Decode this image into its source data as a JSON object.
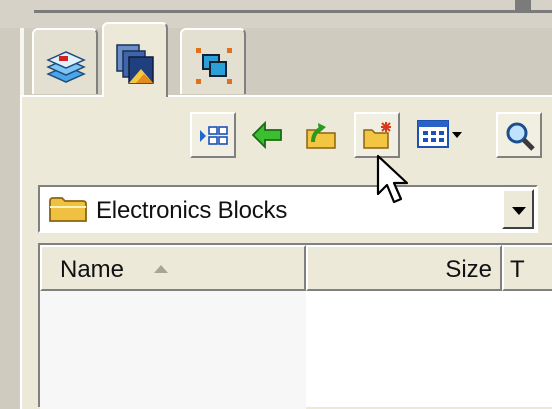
{
  "tabs": [
    {
      "name": "layers",
      "icon": "layers-icon"
    },
    {
      "name": "blocks",
      "icon": "blocks-icon",
      "active": true
    },
    {
      "name": "selection",
      "icon": "selection-icon"
    }
  ],
  "toolbar": {
    "buttons": [
      {
        "icon": "tree-view-icon"
      },
      {
        "icon": "back-arrow-icon"
      },
      {
        "icon": "folder-up-icon"
      },
      {
        "icon": "new-folder-icon"
      },
      {
        "icon": "views-menu-icon"
      },
      {
        "icon": "search-icon"
      }
    ]
  },
  "location": {
    "icon": "folder-icon",
    "label": "Electronics Blocks"
  },
  "file_list": {
    "columns": [
      {
        "label": "Name",
        "sorted": "ascending"
      },
      {
        "label": "Size"
      },
      {
        "label": "T"
      }
    ],
    "rows": []
  },
  "colors": {
    "panel": "#ece9d8",
    "window_bg": "#cfcbbf",
    "list_bg": "#ffffff"
  }
}
